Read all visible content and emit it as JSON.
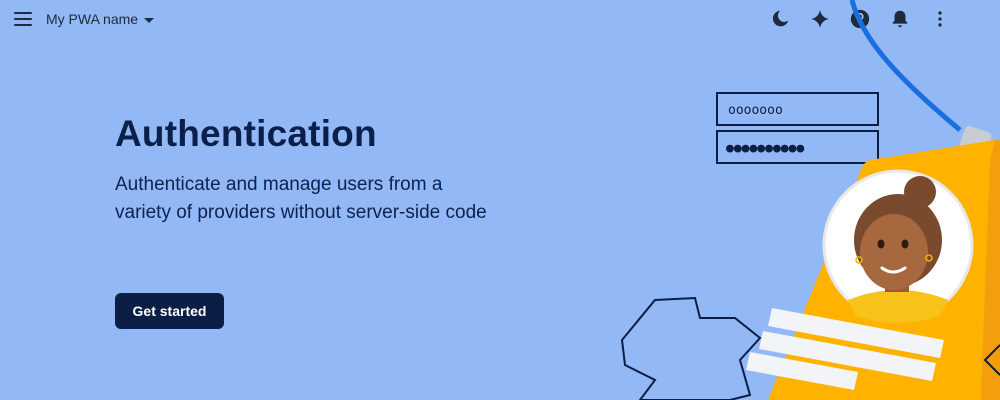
{
  "topbar": {
    "menu_icon": "menu-icon",
    "project_name": "My PWA name",
    "icons": [
      "dark-mode-moon-icon",
      "gemini-sparkle-icon",
      "help-icon",
      "notifications-bell-icon",
      "more-vert-icon"
    ]
  },
  "hero": {
    "title": "Authentication",
    "description": "Authenticate and manage users from a variety of providers without server-side code",
    "cta_label": "Get started"
  },
  "illustration": {
    "username_field_text": "ooooooo",
    "password_field_text": "●●●●●●●●●●"
  },
  "colors": {
    "background": "#92b8f5",
    "title": "#0a1f4a",
    "button_bg": "#0b1e46",
    "badge_yellow": "#ffb300",
    "lanyard_blue": "#1a6ee0"
  }
}
